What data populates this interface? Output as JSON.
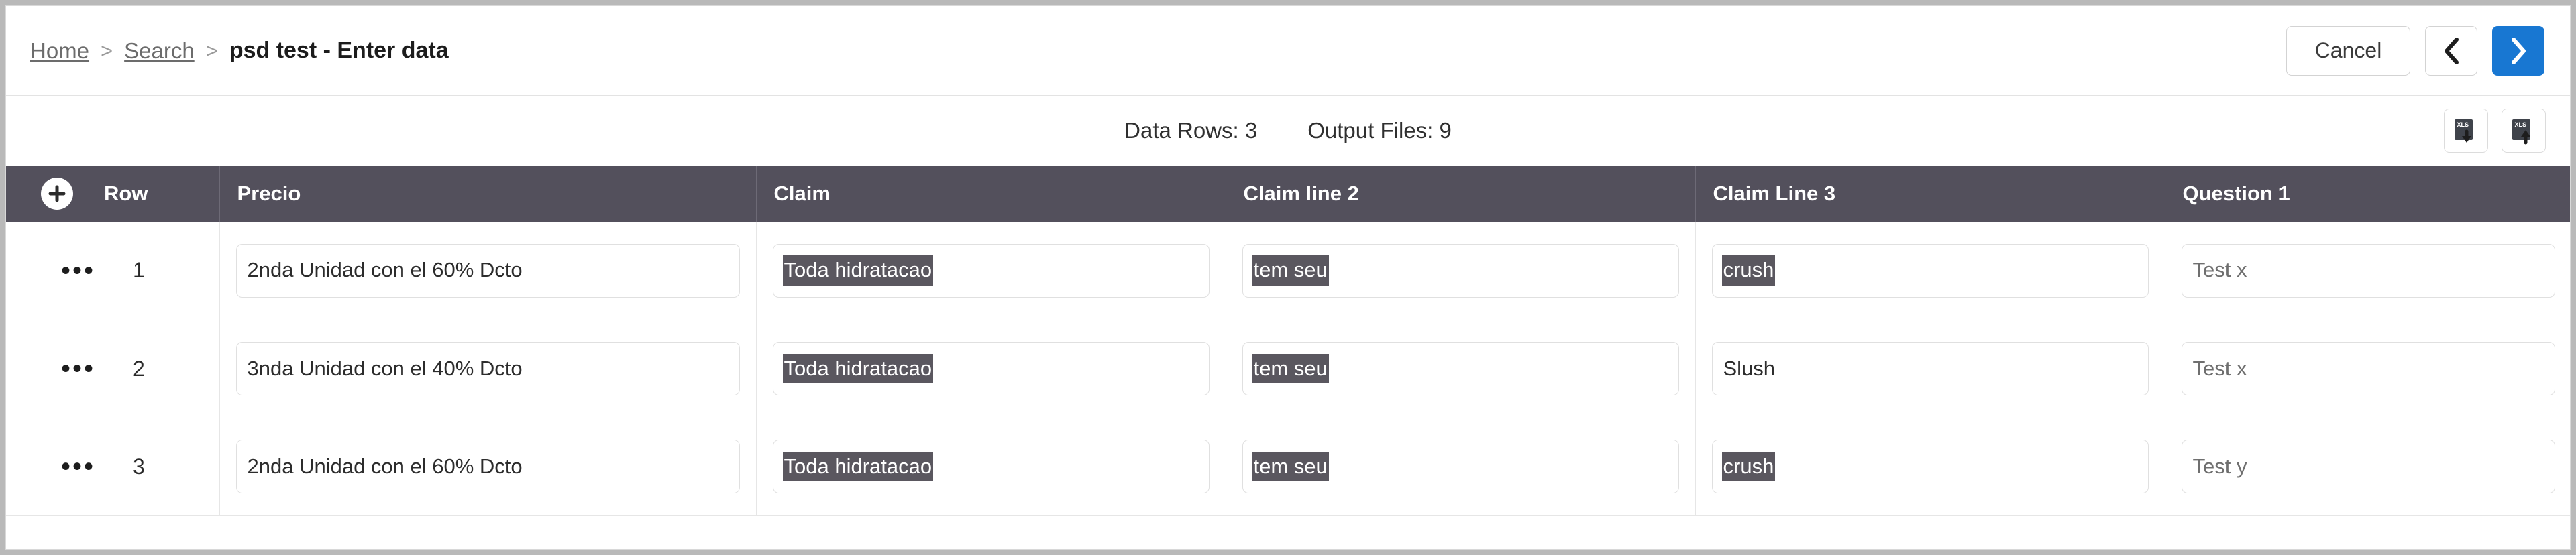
{
  "breadcrumb": {
    "home": "Home",
    "separator": ">",
    "search": "Search",
    "current": "psd test - Enter data"
  },
  "header_actions": {
    "cancel_label": "Cancel",
    "prev_icon": "chevron-left-icon",
    "next_icon": "chevron-right-icon",
    "next_bg": "#1877d2"
  },
  "info_bar": {
    "data_rows": "Data Rows: 3",
    "output_files": "Output Files: 9",
    "xls_download_icon": "xls-download-icon",
    "xls_upload_icon": "xls-upload-icon"
  },
  "table": {
    "add_row_icon": "plus-circle-icon",
    "row_menu_icon": "ellipsis-icon",
    "header_bg": "#53505c",
    "selection_bg": "#5a575f",
    "columns": [
      {
        "key": "row",
        "label": "Row"
      },
      {
        "key": "precio",
        "label": "Precio"
      },
      {
        "key": "claim",
        "label": "Claim"
      },
      {
        "key": "claim2",
        "label": "Claim line 2"
      },
      {
        "key": "claim3",
        "label": "Claim Line 3"
      },
      {
        "key": "question1",
        "label": "Question 1"
      }
    ],
    "rows": [
      {
        "number": "1",
        "precio": "2nda Unidad con el 60% Dcto",
        "claim": "Toda hidratacao",
        "claim_selected": true,
        "claim2": "tem seu",
        "claim2_selected": true,
        "claim3": "crush",
        "claim3_selected": true,
        "question1": "Test x",
        "question1_placeholder": true
      },
      {
        "number": "2",
        "precio": "3nda Unidad con el 40% Dcto",
        "claim": "Toda hidratacao",
        "claim_selected": true,
        "claim2": "tem seu",
        "claim2_selected": true,
        "claim3": "Slush",
        "claim3_selected": false,
        "question1": "Test x",
        "question1_placeholder": true
      },
      {
        "number": "3",
        "precio": "2nda Unidad con el 60% Dcto",
        "claim": "Toda hidratacao",
        "claim_selected": true,
        "claim2": "tem seu",
        "claim2_selected": true,
        "claim3": "crush",
        "claim3_selected": true,
        "question1": "Test y",
        "question1_placeholder": true
      }
    ]
  }
}
